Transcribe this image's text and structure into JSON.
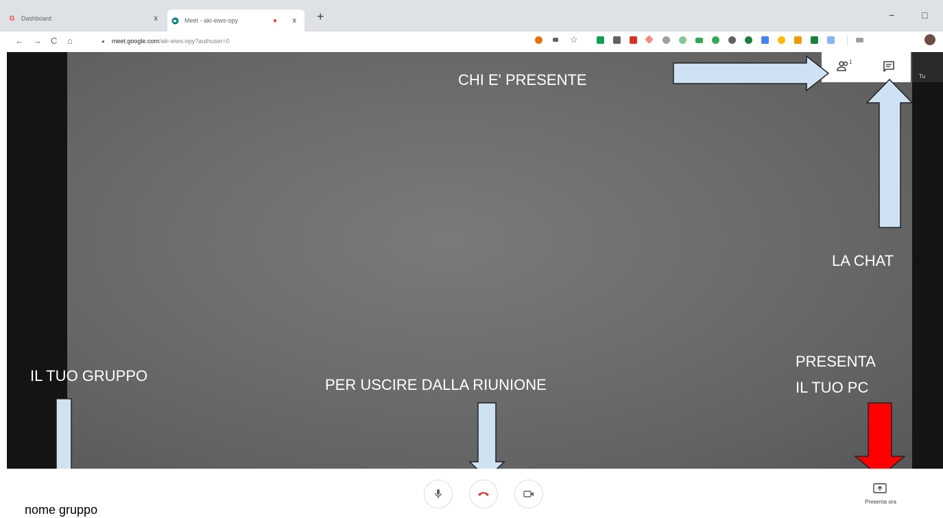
{
  "browser": {
    "tabs": [
      {
        "title": "Dashboard",
        "favicon": "google-g-icon",
        "close": "x"
      },
      {
        "title": "Meet - aki-eiws-opy",
        "favicon": "meet-icon",
        "close": "x",
        "recording_dot": "●"
      }
    ],
    "new_tab": "+",
    "window_controls": {
      "minimize": "−",
      "maximize": "□"
    },
    "nav": {
      "back": "←",
      "forward": "→",
      "reload": "C",
      "home": "⌂"
    },
    "address": {
      "host": "meet.google.com",
      "path": "/aki-eiws-opy?authuser=0"
    }
  },
  "meet": {
    "self_label": "Tu",
    "labels": {
      "chi_presente": "CHI E' PRESENTE",
      "la_chat": "LA CHAT",
      "il_tuo_gruppo": "IL TUO GRUPPO",
      "per_uscire": "PER USCIRE DALLA RIUNIONE",
      "presenta_1": "PRESENTA",
      "presenta_2": "IL TUO PC"
    },
    "participants_count": "1",
    "group_name": "nome gruppo",
    "present_now": "Presenta ora"
  },
  "colors": {
    "arrow": "#cfe2f3",
    "arrow_red": "#ff0000",
    "hangup": "#d93025"
  }
}
